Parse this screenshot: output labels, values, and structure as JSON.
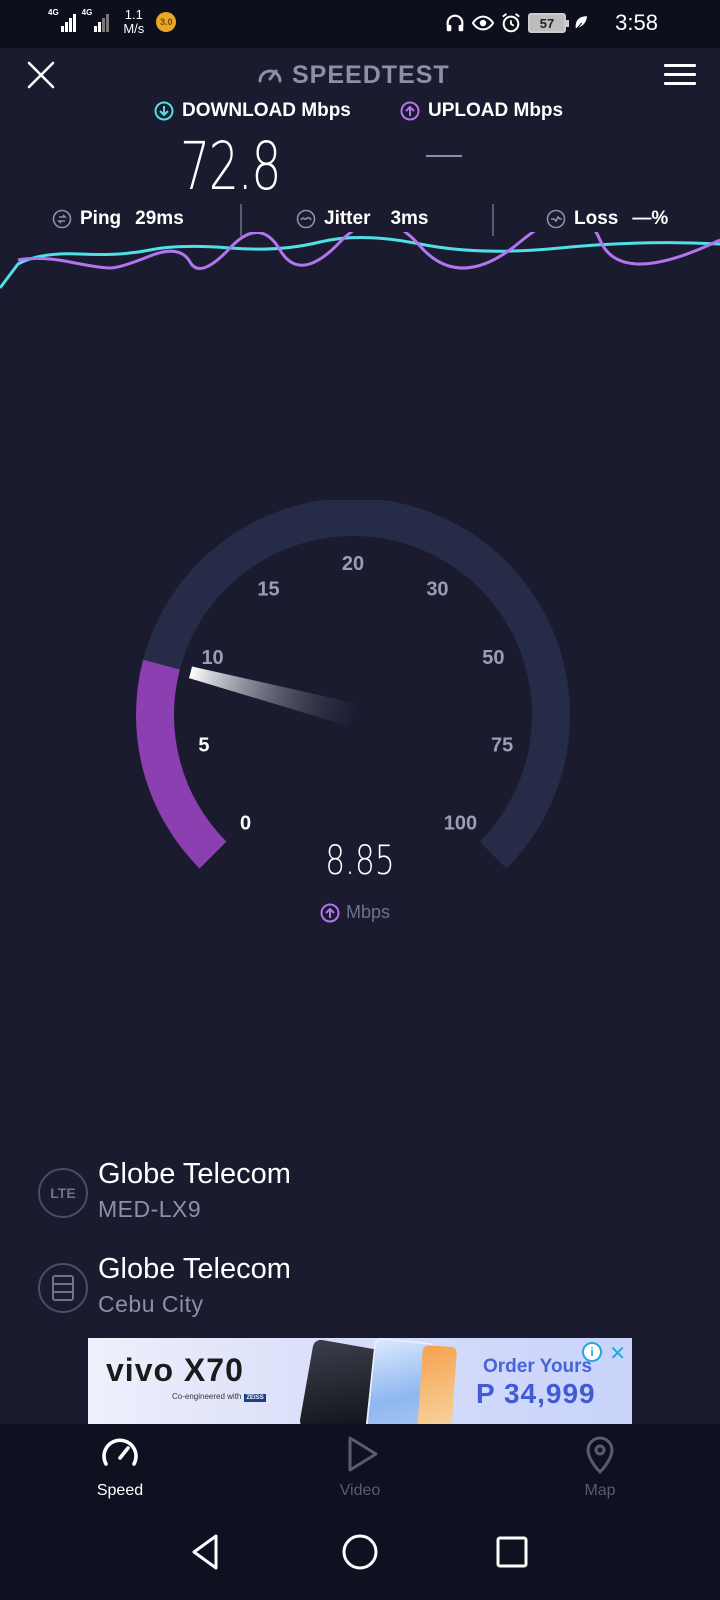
{
  "status_bar": {
    "net1": "4G",
    "net2": "4G",
    "speed_value": "1.1",
    "speed_unit": "M/s",
    "coin_badge": "3.0",
    "battery": "57",
    "time": "3:58"
  },
  "header": {
    "title": "SPEEDTEST"
  },
  "results": {
    "download_label": "DOWNLOAD Mbps",
    "download_value": "72.8",
    "upload_label": "UPLOAD Mbps",
    "upload_value": ""
  },
  "metrics": {
    "ping_label": "Ping",
    "ping_value": "29ms",
    "jitter_label": "Jitter",
    "jitter_value": "3ms",
    "loss_label": "Loss",
    "loss_value": "—%"
  },
  "gauge": {
    "ticks": [
      "0",
      "5",
      "10",
      "15",
      "20",
      "30",
      "50",
      "75",
      "100"
    ],
    "value": "8.85",
    "unit": "Mbps",
    "current": 8.85,
    "max": 100,
    "colors": {
      "track": "#262c47",
      "fill": "#8b3fb0",
      "needle": "#ffffff"
    }
  },
  "providers": [
    {
      "icon": "LTE",
      "name": "Globe Telecom",
      "detail": "MED-LX9"
    },
    {
      "icon": "server-icon",
      "name": "Globe Telecom",
      "detail": "Cebu City"
    }
  ],
  "ad": {
    "brand": "vivo X70",
    "tagline": "Co-engineered with",
    "partner": "ZEISS",
    "cta_line1": "Order Yours",
    "cta_line2": "P 34,999"
  },
  "bottom_nav": [
    {
      "label": "Speed",
      "icon": "speedometer-icon",
      "active": true
    },
    {
      "label": "Video",
      "icon": "play-icon",
      "active": false
    },
    {
      "label": "Map",
      "icon": "map-pin-icon",
      "active": false
    }
  ],
  "colors": {
    "background": "#1a1b2e",
    "download_accent": "#4fe0e8",
    "upload_accent": "#b374f0",
    "muted_text": "#8c8fa8"
  }
}
